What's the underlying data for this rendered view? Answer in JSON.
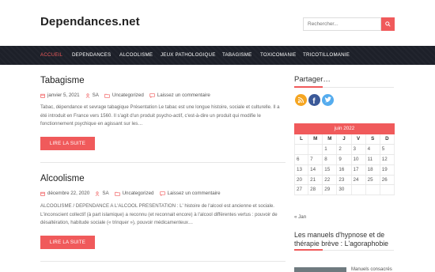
{
  "site": {
    "title": "Dependances.net"
  },
  "search": {
    "placeholder": "Rechercher...",
    "icon": "search-icon"
  },
  "nav": {
    "items": [
      {
        "label": "ACCUEIL",
        "active": true
      },
      {
        "label": "DEPENDANCES"
      },
      {
        "label": "ALCOOLISME"
      },
      {
        "label": "JEUX PATHOLOGIQUE"
      },
      {
        "label": "TABAGISME"
      },
      {
        "label": "TOXICOMANIE"
      },
      {
        "label": "TRICOTILLOMANIE"
      }
    ]
  },
  "posts": [
    {
      "title": "Tabagisme",
      "date": "janvier 5, 2021",
      "author": "SA",
      "category": "Uncategorized",
      "comments": "Laissez un commentaire",
      "excerpt": "Tabac, dépendance et sevrage tabagique Présentation Le tabac est une longue histoire, sociale et culturelle. Il a été introduit en France vers 1560. Il s'agit d'un produit psycho-actif, c'est-à-dire un produit qui modifie le fonctionnement psychique en agissant sur les…",
      "read_more": "LIRE LA SUITE"
    },
    {
      "title": "Alcoolisme",
      "date": "décembre 22, 2020",
      "author": "SA",
      "category": "Uncategorized",
      "comments": "Laissez un commentaire",
      "excerpt": "ALCOOLISME / DEPENDANCE A L'ALCOOL PRESENTATION : L' histoire de l'alcool est ancienne et sociale. L'inconscient collectif (à part islamique) a reconnu (et reconnait encore) à l'alcool différentes vertus : pouvoir de désaltération, habitude sociale (« trinquer »), pouvoir médicamenteux…",
      "read_more": "LIRE LA SUITE"
    }
  ],
  "sidebar": {
    "share_title": "Partager…",
    "share_icons": [
      "rss-icon",
      "facebook-icon",
      "twitter-icon"
    ],
    "calendar": {
      "caption": "juin 2022",
      "days": [
        "L",
        "M",
        "M",
        "J",
        "V",
        "S",
        "D"
      ],
      "rows": [
        [
          "",
          "",
          "1",
          "2",
          "3",
          "4",
          "5"
        ],
        [
          "6",
          "7",
          "8",
          "9",
          "10",
          "11",
          "12"
        ],
        [
          "13",
          "14",
          "15",
          "16",
          "17",
          "18",
          "19"
        ],
        [
          "20",
          "21",
          "22",
          "23",
          "24",
          "25",
          "26"
        ],
        [
          "27",
          "28",
          "29",
          "30",
          "",
          "",
          ""
        ]
      ],
      "prev": "« Jan"
    },
    "hypnose_title": "Les manuels d'hypnose et de thérapie brève : L'agoraphobie",
    "hypnose_item": "Manuels consacrés"
  },
  "colors": {
    "accent": "#f05a5b",
    "nav_bg": "#1d2029"
  }
}
